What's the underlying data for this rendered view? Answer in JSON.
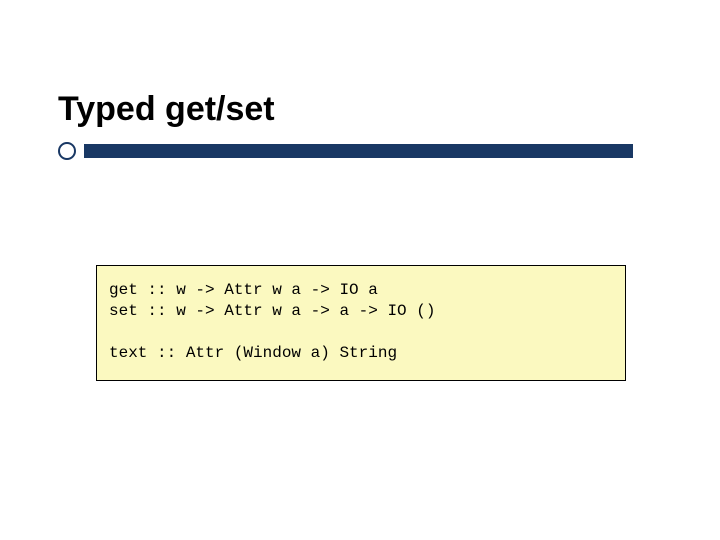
{
  "slide": {
    "title": "Typed get/set"
  },
  "code": {
    "line1": "get :: w -> Attr w a -> IO a",
    "line2": "set :: w -> Attr w a -> a -> IO ()",
    "line3": "text :: Attr (Window a) String"
  }
}
